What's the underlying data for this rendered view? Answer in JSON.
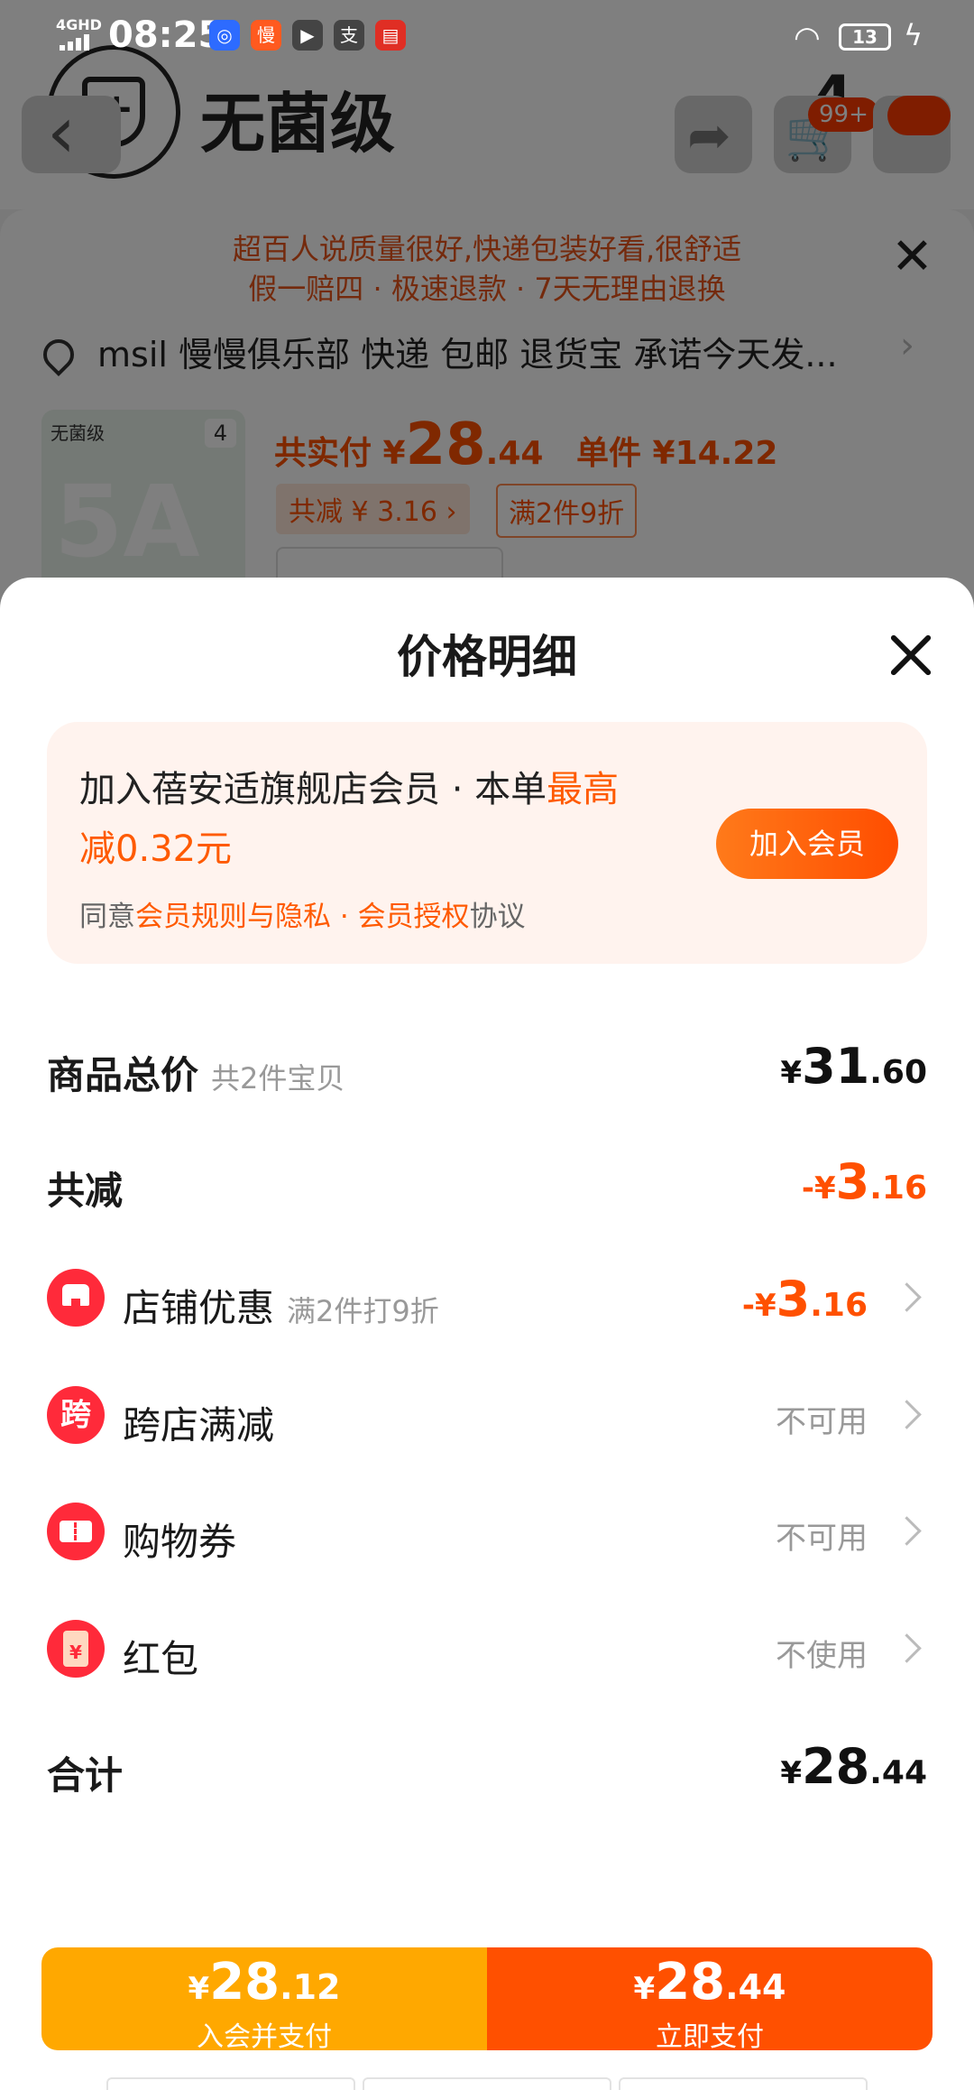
{
  "status_bar": {
    "network": "4GHD",
    "time": "08:25",
    "battery": "13",
    "app_icons": [
      {
        "name": "baidu-map-icon",
        "glyph": "◎",
        "color": "#2d6bff"
      },
      {
        "name": "manman-app-icon",
        "glyph": "慢",
        "color": "#ff5a1f"
      },
      {
        "name": "video-app-icon",
        "glyph": "▶",
        "color": "#444444"
      },
      {
        "name": "alipay-icon",
        "glyph": "支",
        "color": "#444444"
      },
      {
        "name": "pdd-app-icon",
        "glyph": "▤",
        "color": "#e02e24"
      }
    ]
  },
  "background": {
    "brand_name": "无菌级",
    "cart_badge": "99+",
    "big_number": "4",
    "banner_line1": "超百人说质量很好,快递包装好看,很舒适",
    "banner_line2": "假一赔四 · 极速退款 · 7天无理由退换",
    "address": "msil 慢慢俱乐部  快递 包邮 退货宝 承诺今天发...",
    "thumb_label": "无菌级",
    "thumb_count": "4",
    "thumb_text": "5A",
    "price_prefix": "共实付 ¥",
    "price_int": "28",
    "price_dec": ".44",
    "unit_price": "单件 ¥14.22",
    "discount_tag": "共减 ¥ 3.16 ›",
    "promo_tag": "满2件9折"
  },
  "sheet": {
    "title": "价格明细",
    "member": {
      "line1_prefix": "加入蓓安适旗舰店会员 · 本单",
      "line1_highlight": "最高",
      "line2": "减0.32元",
      "agree_prefix": "同意",
      "agree_link1": "会员规则与隐私",
      "agree_sep": " · ",
      "agree_link2": "会员授权",
      "agree_suffix": "协议",
      "button": "加入会员"
    },
    "rows": {
      "total": {
        "label": "商品总价",
        "sub": "共2件宝贝",
        "yen": "¥",
        "int": "31",
        "dec": ".60"
      },
      "reduce": {
        "label": "共减",
        "yen": "-¥",
        "int": "3",
        "dec": ".16"
      },
      "store": {
        "label": "店铺优惠",
        "sub": "满2件打9折",
        "yen": "-¥",
        "int": "3",
        "dec": ".16"
      },
      "cross": {
        "label": "跨店满减",
        "icon_text": "跨",
        "status": "不可用"
      },
      "voucher": {
        "label": "购物券",
        "status": "不可用"
      },
      "redpacket": {
        "label": "红包",
        "icon_text": "¥",
        "status": "不使用"
      },
      "sum": {
        "label": "合计",
        "yen": "¥",
        "int": "28",
        "dec": ".44"
      }
    }
  },
  "paybar": {
    "left": {
      "yen": "¥",
      "int": "28",
      "dec": ".12",
      "caption": "入会并支付",
      "color": "#ffa800"
    },
    "right": {
      "yen": "¥",
      "int": "28",
      "dec": ".44",
      "caption": "立即支付",
      "color": "#ff5000"
    }
  }
}
